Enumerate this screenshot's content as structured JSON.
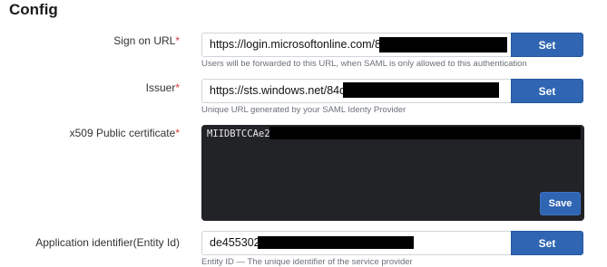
{
  "page": {
    "title": "Config"
  },
  "fields": {
    "sign_on": {
      "label": "Sign on URL",
      "required_mark": "*",
      "value": "https://login.microsoftonline.com/84d8",
      "help": "Users will be forwarded to this URL, when SAML is only allowed to this authentication",
      "button": "Set"
    },
    "issuer": {
      "label": "Issuer",
      "required_mark": "*",
      "value": "https://sts.windows.net/84d8",
      "help": "Unique URL generated by your SAML Identy Provider",
      "button": "Set"
    },
    "certificate": {
      "label": "x509 Public certificate",
      "required_mark": "*",
      "value": "MIIDBTCCAe2gA",
      "button": "Save"
    },
    "entity_id": {
      "label": "Application identifier(Entity Id)",
      "value": "de455302-",
      "help": "Entity ID — The unique identifier of the service provider",
      "button": "Set"
    }
  },
  "colors": {
    "accent": "#2f65b3",
    "required": "#d63a3a",
    "editor_bg": "#222327"
  }
}
